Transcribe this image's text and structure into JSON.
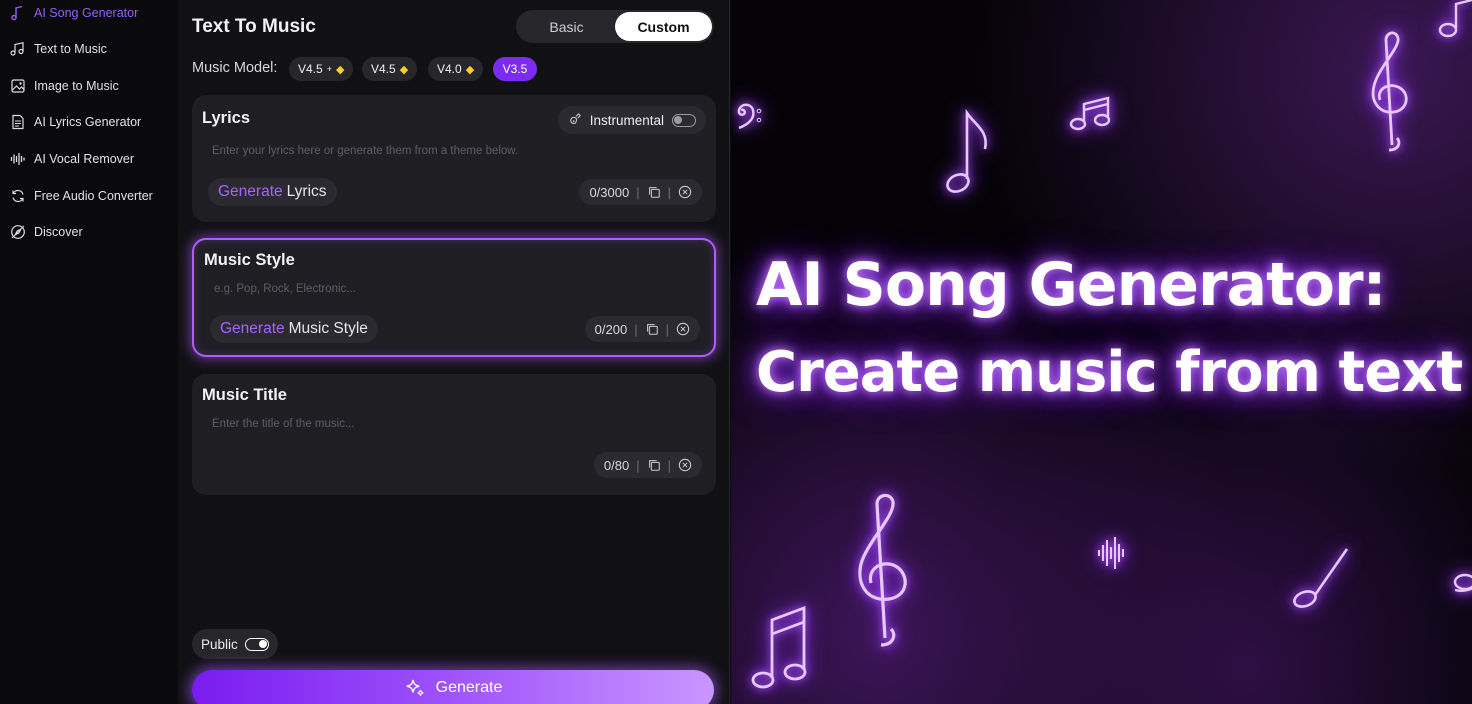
{
  "sidebar": {
    "items": [
      {
        "label": "AI Song Generator",
        "icon": "music-note-icon",
        "active": true
      },
      {
        "label": "Text to Music",
        "icon": "music-notes-icon",
        "active": false
      },
      {
        "label": "Image to Music",
        "icon": "image-icon",
        "active": false
      },
      {
        "label": "AI Lyrics Generator",
        "icon": "document-icon",
        "active": false
      },
      {
        "label": "AI Vocal Remover",
        "icon": "waveform-icon",
        "active": false
      },
      {
        "label": "Free Audio Converter",
        "icon": "convert-icon",
        "active": false
      },
      {
        "label": "Discover",
        "icon": "compass-icon",
        "active": false
      }
    ]
  },
  "panel": {
    "title": "Text To Music",
    "modes": {
      "basic": "Basic",
      "custom": "Custom",
      "selected": "Custom"
    },
    "model_label": "Music Model:",
    "models": [
      {
        "label": "V4.5",
        "suffix": "+",
        "premium": true
      },
      {
        "label": "V4.5",
        "suffix": "",
        "premium": true
      },
      {
        "label": "V4.0",
        "suffix": "",
        "premium": true
      },
      {
        "label": "V3.5",
        "suffix": "",
        "premium": false,
        "selected": true
      }
    ],
    "lyrics": {
      "title": "Lyrics",
      "instrumental_label": "Instrumental",
      "instrumental_on": false,
      "placeholder": "Enter your lyrics here or generate them from a theme below.",
      "gen_accent": "Generate",
      "gen_rest": "Lyrics",
      "counter": "0/3000"
    },
    "style": {
      "title": "Music Style",
      "placeholder": "e.g. Pop, Rock, Electronic...",
      "gen_accent": "Generate",
      "gen_rest": "Music Style",
      "counter": "0/200"
    },
    "music_title": {
      "title": "Music Title",
      "placeholder": "Enter the title of the music...",
      "counter": "0/80"
    },
    "public_label": "Public",
    "public_on": true,
    "generate_label": "Generate"
  },
  "hero": {
    "line1": "AI Song Generator:",
    "line2": "Create music from text"
  },
  "colors": {
    "accent": "#9a5bff",
    "generate_gradient_start": "#7a1cf0",
    "generate_gradient_end": "#c996ff",
    "premium_gem": "#f6d22c"
  }
}
